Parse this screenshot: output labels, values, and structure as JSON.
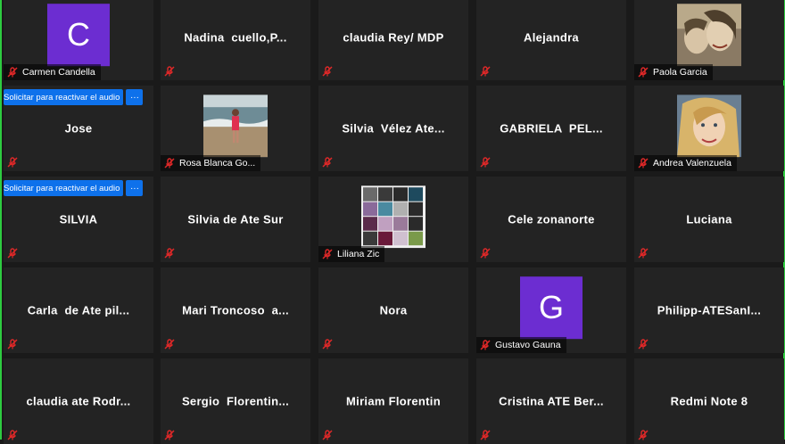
{
  "colors": {
    "tile_bg": "#232323",
    "accent_blue": "#0e71eb",
    "muted_red": "#e02828",
    "avatar_purple": "#6c2dd1",
    "frame_green": "#2ecc40"
  },
  "request_audio": {
    "label": "Solicitar para reactivar el audio",
    "more_label": "···"
  },
  "participants": [
    {
      "name": "Carmen Candella",
      "display": "",
      "avatar": "C",
      "photo": "",
      "muted": true
    },
    {
      "name": "",
      "display": "Nadina  cuello,P...",
      "avatar": "",
      "photo": "",
      "muted": true
    },
    {
      "name": "",
      "display": "claudia Rey/ MDP",
      "avatar": "",
      "photo": "",
      "muted": true
    },
    {
      "name": "",
      "display": "Alejandra",
      "avatar": "",
      "photo": "",
      "muted": true
    },
    {
      "name": "Paola Garcia",
      "display": "",
      "avatar": "",
      "photo": "selfie",
      "muted": true
    },
    {
      "name": "",
      "display": "Jose",
      "avatar": "",
      "photo": "",
      "muted": true,
      "request_audio": true
    },
    {
      "name": "Rosa Blanca Go...",
      "display": "",
      "avatar": "",
      "photo": "beach",
      "muted": true
    },
    {
      "name": "",
      "display": "Silvia  Vélez Ate...",
      "avatar": "",
      "photo": "",
      "muted": true
    },
    {
      "name": "",
      "display": "GABRIELA  PEL...",
      "avatar": "",
      "photo": "",
      "muted": true
    },
    {
      "name": "Andrea Valenzuela",
      "display": "",
      "avatar": "",
      "photo": "blonde",
      "muted": true
    },
    {
      "name": "",
      "display": "SILVIA",
      "avatar": "",
      "photo": "",
      "muted": true,
      "request_audio": true
    },
    {
      "name": "",
      "display": "Silvia de Ate Sur",
      "avatar": "",
      "photo": "",
      "muted": true
    },
    {
      "name": "Liliana Zic",
      "display": "",
      "avatar": "",
      "photo": "collage",
      "muted": true
    },
    {
      "name": "",
      "display": "Cele zonanorte",
      "avatar": "",
      "photo": "",
      "muted": true
    },
    {
      "name": "",
      "display": "Luciana",
      "avatar": "",
      "photo": "",
      "muted": true
    },
    {
      "name": "",
      "display": "Carla  de Ate pil...",
      "avatar": "",
      "photo": "",
      "muted": true
    },
    {
      "name": "",
      "display": "Mari Troncoso  a...",
      "avatar": "",
      "photo": "",
      "muted": true
    },
    {
      "name": "",
      "display": "Nora",
      "avatar": "",
      "photo": "",
      "muted": true
    },
    {
      "name": "Gustavo Gauna",
      "display": "",
      "avatar": "G",
      "photo": "",
      "muted": true
    },
    {
      "name": "",
      "display": "Philipp-ATESanI...",
      "avatar": "",
      "photo": "",
      "muted": true
    },
    {
      "name": "",
      "display": "claudia ate Rodr...",
      "avatar": "",
      "photo": "",
      "muted": true
    },
    {
      "name": "",
      "display": "Sergio  Florentin...",
      "avatar": "",
      "photo": "",
      "muted": true
    },
    {
      "name": "",
      "display": "Miriam Florentin",
      "avatar": "",
      "photo": "",
      "muted": true
    },
    {
      "name": "",
      "display": "Cristina ATE Ber...",
      "avatar": "",
      "photo": "",
      "muted": true
    },
    {
      "name": "",
      "display": "Redmi Note 8",
      "avatar": "",
      "photo": "",
      "muted": true
    }
  ]
}
